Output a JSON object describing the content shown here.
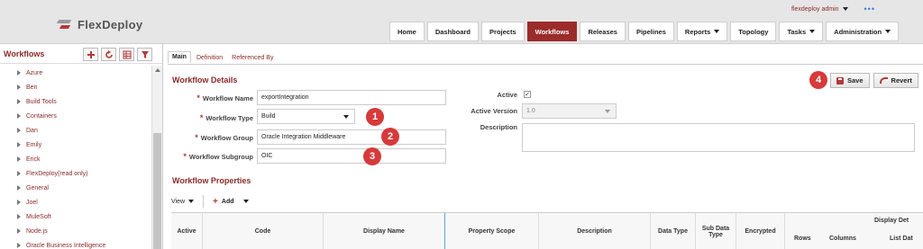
{
  "header": {
    "brand": "FlexDeploy",
    "user": "flexdeploy admin",
    "more": "•••",
    "nav": [
      {
        "label": "Home"
      },
      {
        "label": "Dashboard"
      },
      {
        "label": "Projects"
      },
      {
        "label": "Workflows",
        "active": true
      },
      {
        "label": "Releases"
      },
      {
        "label": "Pipelines"
      },
      {
        "label": "Reports",
        "dropdown": true
      },
      {
        "label": "Topology"
      },
      {
        "label": "Tasks",
        "dropdown": true
      },
      {
        "label": "Administration",
        "dropdown": true
      }
    ]
  },
  "sidebar": {
    "title": "Workflows",
    "tools": [
      "add-icon",
      "refresh-icon",
      "table-icon",
      "filter-icon"
    ],
    "items": [
      "Azure",
      "Ben",
      "Build Tools",
      "Containers",
      "Dan",
      "Emily",
      "Erick",
      "FlexDeploy(read only)",
      "General",
      "Joel",
      "MuleSoft",
      "Node.js",
      "Oracle Business Intelligence"
    ]
  },
  "tabs": [
    {
      "label": "Main",
      "active": true
    },
    {
      "label": "Definition"
    },
    {
      "label": "Referenced By"
    }
  ],
  "details": {
    "title": "Workflow Details",
    "name_label": "Workflow Name",
    "name_value": "exportIntegration",
    "type_label": "Workflow Type",
    "type_value": "Build",
    "group_label": "Workflow Group",
    "group_value": "Oracle Integration Middleware",
    "subgroup_label": "Workflow Subgroup",
    "subgroup_value": "OIC",
    "active_label": "Active",
    "active_checked": true,
    "active_version_label": "Active Version",
    "active_version_value": "1.0",
    "description_label": "Description",
    "description_value": ""
  },
  "actions": {
    "save": "Save",
    "revert": "Revert"
  },
  "badges": [
    "1",
    "2",
    "3",
    "4"
  ],
  "properties": {
    "title": "Workflow Properties",
    "view_label": "View",
    "add_label": "Add",
    "columns": [
      "Active",
      "Code",
      "Display Name",
      "Property Scope",
      "Description",
      "Data Type",
      "Sub Data Type",
      "Encrypted"
    ],
    "group_header": "Display Det",
    "sub_columns": [
      "Rows",
      "Columns",
      "List Dat"
    ]
  },
  "colors": {
    "brand": "#9c2b2b",
    "badge": "#d63a3a",
    "link": "#8a2a2a"
  }
}
